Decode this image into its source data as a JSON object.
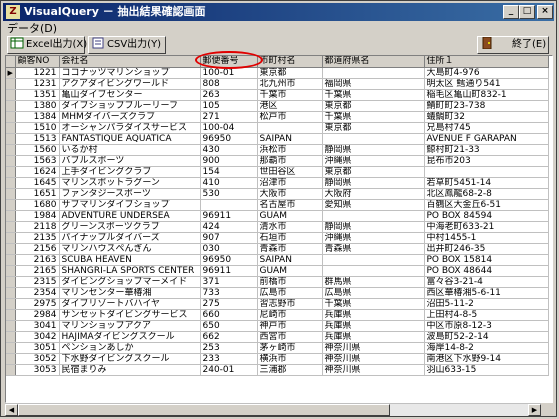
{
  "window": {
    "title": "VisualQuery － 抽出結果確認画面",
    "app_icon": "Z"
  },
  "menu": {
    "data_label": "データ(D)"
  },
  "toolbar": {
    "excel_label": "Excel出力(X)",
    "csv_label": "CSV出力(Y)",
    "exit_label": "終了(E)"
  },
  "columns": [
    "顧客NO",
    "会社名",
    "郵便番号",
    "市町村名",
    "都道府県名",
    "住所１"
  ],
  "rows": [
    [
      "1221",
      "ココナッツマリンショップ",
      "100-01",
      "東京都",
      "",
      "大島町4-976"
    ],
    [
      "1231",
      "アクアダイビングワールド",
      "808",
      "北九州市",
      "福岡県",
      "明太区 鱈通り541"
    ],
    [
      "1351",
      "亀山ダイブセンター",
      "263",
      "千葉市",
      "千葉県",
      "稲毛区亀山町832-1"
    ],
    [
      "1380",
      "ダイブショップブルーリーフ",
      "105",
      "港区",
      "東京都",
      "鯖町町23-738"
    ],
    [
      "1384",
      "MHMダイバーズクラブ",
      "271",
      "松戸市",
      "千葉県",
      "蟻鯛町32"
    ],
    [
      "1510",
      "オーシャンパラダイスサービス",
      "100-04",
      "",
      "東京都",
      "兄島村745"
    ],
    [
      "1513",
      "FANTASTIQUE AQUATICA",
      "96950",
      "SAIPAN",
      "",
      "AVENUE F GARAPAN"
    ],
    [
      "1560",
      "いるか村",
      "430",
      "浜松市",
      "静岡県",
      "鯨村町21-33"
    ],
    [
      "1563",
      "バブルスポーツ",
      "900",
      "那覇市",
      "沖縄県",
      "昆布市203"
    ],
    [
      "1624",
      "上手ダイビングクラブ",
      "154",
      "世田谷区",
      "東京都",
      ""
    ],
    [
      "1645",
      "マリンスポットラグーン",
      "410",
      "沼津市",
      "静岡県",
      "若草町5451-14"
    ],
    [
      "1651",
      "ファンタジースポーツ",
      "530",
      "大阪市",
      "大阪府",
      "北区鳳龍68-2-8"
    ],
    [
      "1680",
      "サブマリンダイブショップ",
      "",
      "名古屋市",
      "愛知県",
      "百鶴区大金丘6-51"
    ],
    [
      "1984",
      "ADVENTURE UNDERSEA",
      "96911",
      "GUAM",
      "",
      "PO BOX 84594"
    ],
    [
      "2118",
      "グリーンスポーツクラブ",
      "424",
      "清水市",
      "静岡県",
      "中海老町633-21"
    ],
    [
      "2135",
      "パイナップルダイバーズ",
      "907",
      "石垣市",
      "沖縄県",
      "中村1455-1"
    ],
    [
      "2156",
      "マリンハウスぺんぎん",
      "030",
      "青森市",
      "青森県",
      "出井町246-35"
    ],
    [
      "2163",
      "SCUBA HEAVEN",
      "96950",
      "SAIPAN",
      "",
      "PO BOX 15814"
    ],
    [
      "2165",
      "SHANGRI-LA SPORTS CENTER",
      "96911",
      "GUAM",
      "",
      "PO BOX 48644"
    ],
    [
      "2315",
      "ダイビングショップマーメイド",
      "371",
      "前橋市",
      "群馬県",
      "富々谷3-21-4"
    ],
    [
      "2354",
      "マリンセンター華椿湘",
      "733",
      "広島市",
      "広島県",
      "西区華椿湘5-6-11"
    ],
    [
      "2975",
      "ダイブリゾートバハイヤ",
      "275",
      "習志野市",
      "千葉県",
      "沼田5-11-2"
    ],
    [
      "2984",
      "サンセットダイビングサービス",
      "660",
      "尼崎市",
      "兵庫県",
      "上田村4-8-5"
    ],
    [
      "3041",
      "マリンショップアクア",
      "650",
      "神戸市",
      "兵庫県",
      "中区市原8-12-3"
    ],
    [
      "3042",
      "HAJIMAダイビングスクール",
      "662",
      "西宮市",
      "兵庫県",
      "波島町52-2-14"
    ],
    [
      "3051",
      "ペンションあしか",
      "253",
      "茅ヶ崎市",
      "神奈川県",
      "海岸14-8-2"
    ],
    [
      "3052",
      "下水野ダイビングスクール",
      "233",
      "横浜市",
      "神奈川県",
      "南港区下水野9-14"
    ],
    [
      "3053",
      "民宿まりみ",
      "240-01",
      "三浦郡",
      "神奈川県",
      "羽山633-15"
    ]
  ]
}
